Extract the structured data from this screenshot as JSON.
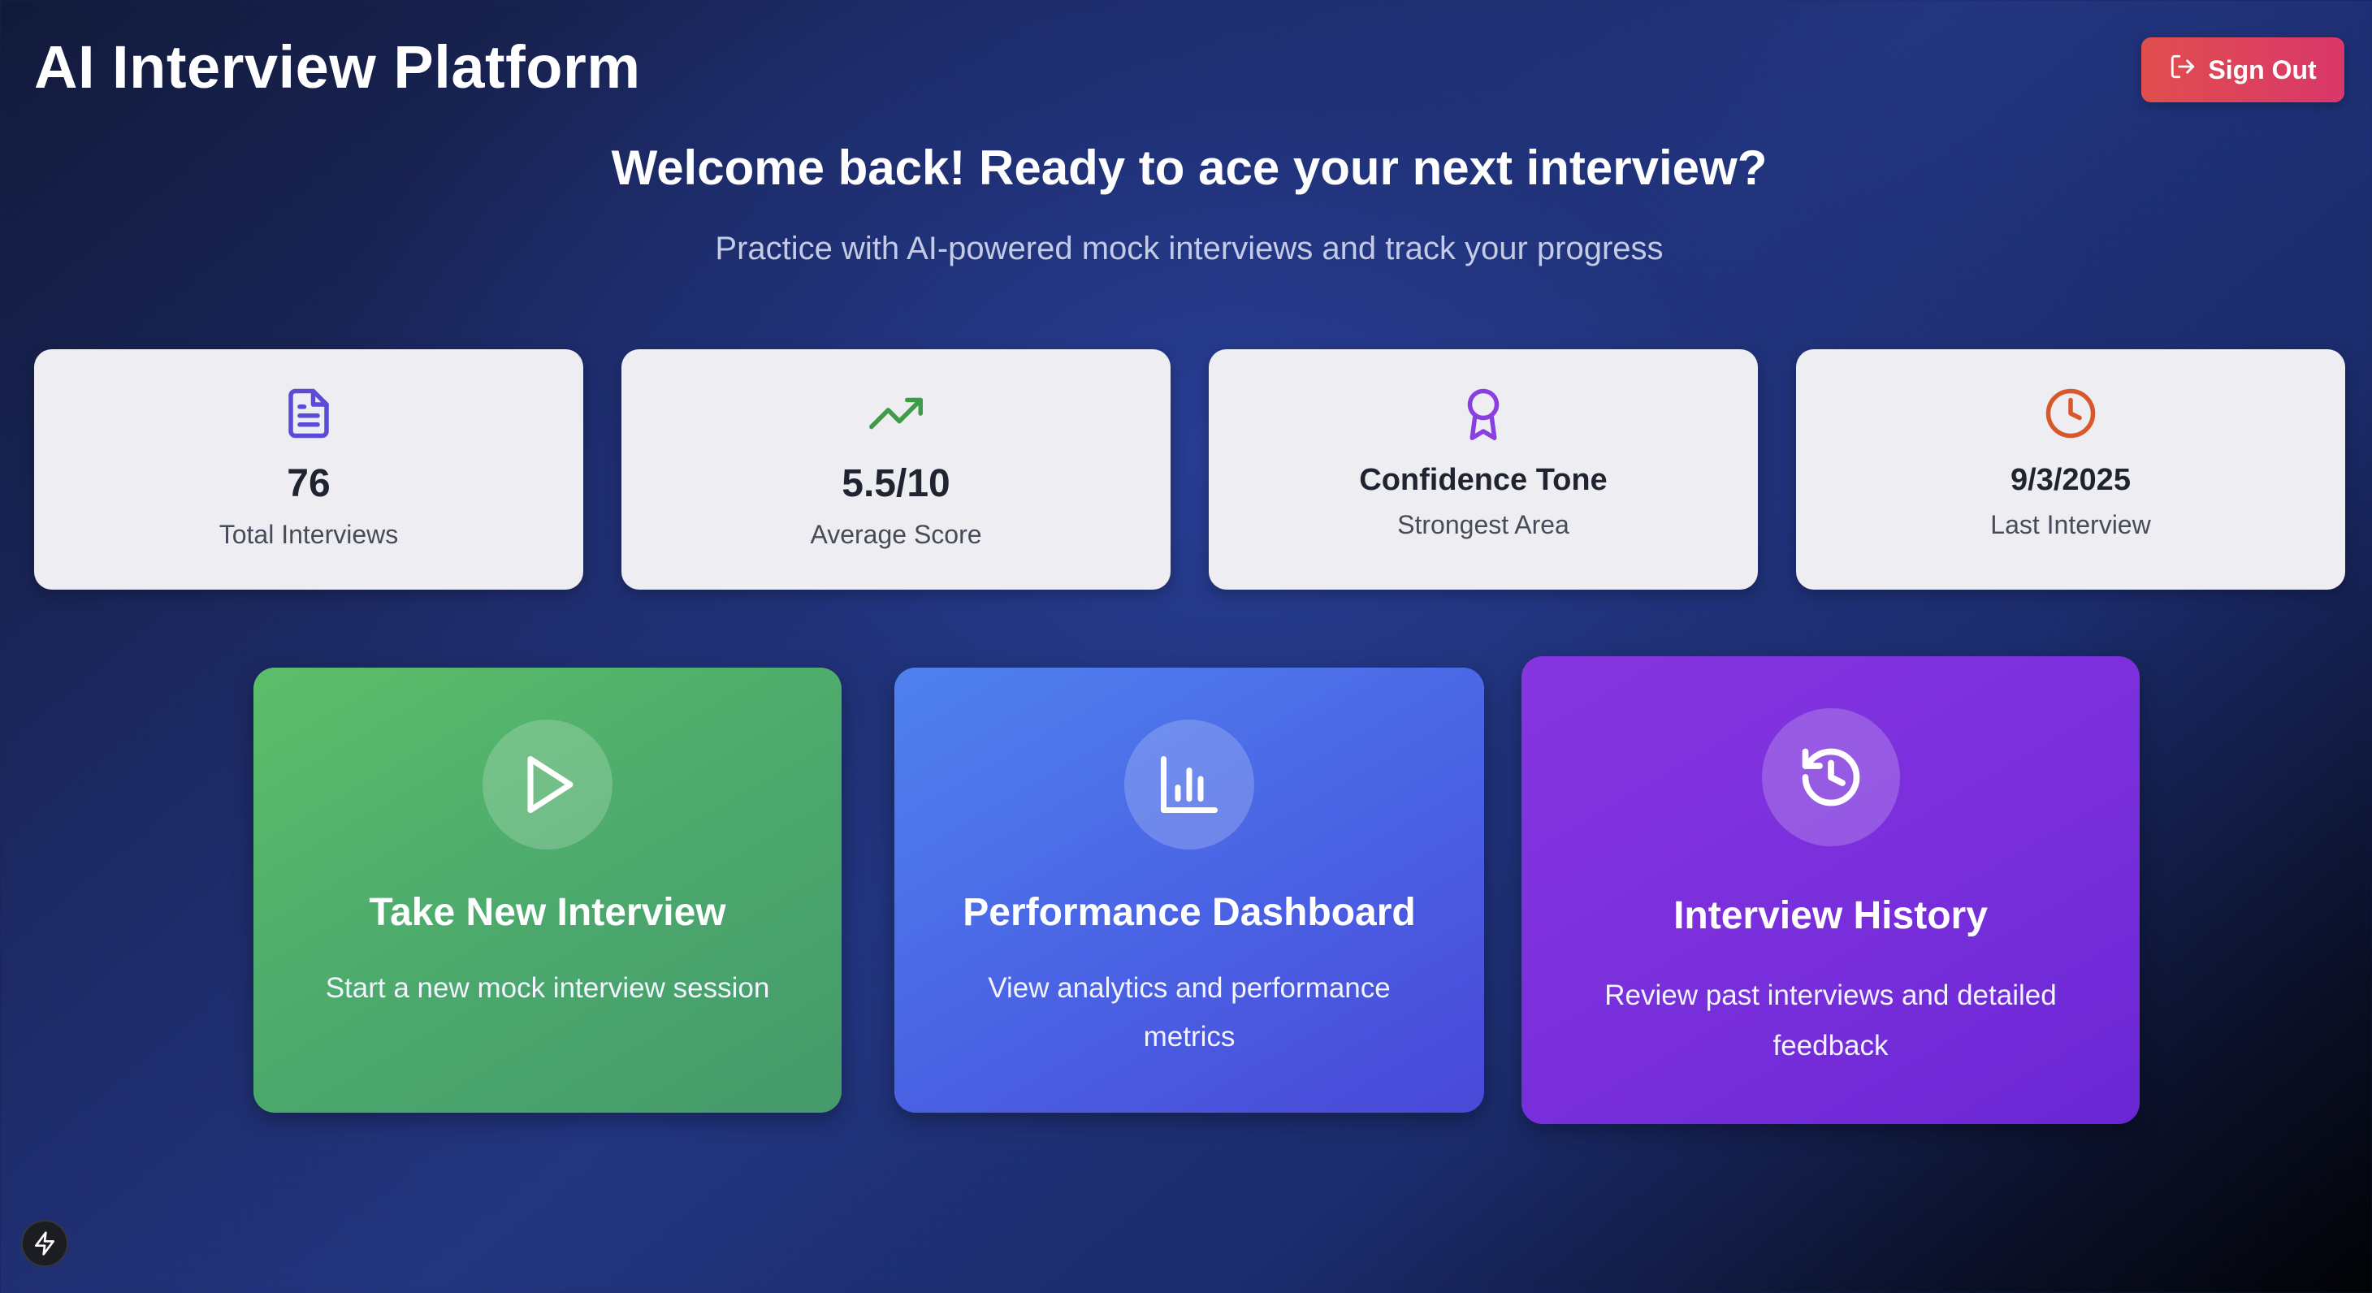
{
  "header": {
    "app_title": "AI Interview Platform",
    "sign_out_label": "Sign Out",
    "sign_out_icon": "logout-icon"
  },
  "hero": {
    "title": "Welcome back! Ready to ace your next interview?",
    "subtitle": "Practice with AI-powered mock interviews and track your progress"
  },
  "stats": [
    {
      "icon": "document-icon",
      "value": "76",
      "label": "Total Interviews",
      "color": "#5b4bd8"
    },
    {
      "icon": "trending-up-icon",
      "value": "5.5/10",
      "label": "Average Score",
      "color": "#3f9a4a"
    },
    {
      "icon": "award-icon",
      "value": "Confidence Tone",
      "label": "Strongest Area",
      "color": "#8a3fe0"
    },
    {
      "icon": "clock-icon",
      "value": "9/3/2025",
      "label": "Last Interview",
      "color": "#d9582b"
    }
  ],
  "actions": [
    {
      "icon": "play-icon",
      "title": "Take New Interview",
      "description": "Start a new mock interview session"
    },
    {
      "icon": "bar-chart-icon",
      "title": "Performance Dashboard",
      "description": "View analytics and performance metrics"
    },
    {
      "icon": "history-icon",
      "title": "Interview History",
      "description": "Review past interviews and detailed feedback"
    }
  ],
  "footer": {
    "badge_icon": "lightning-bolt-icon"
  }
}
